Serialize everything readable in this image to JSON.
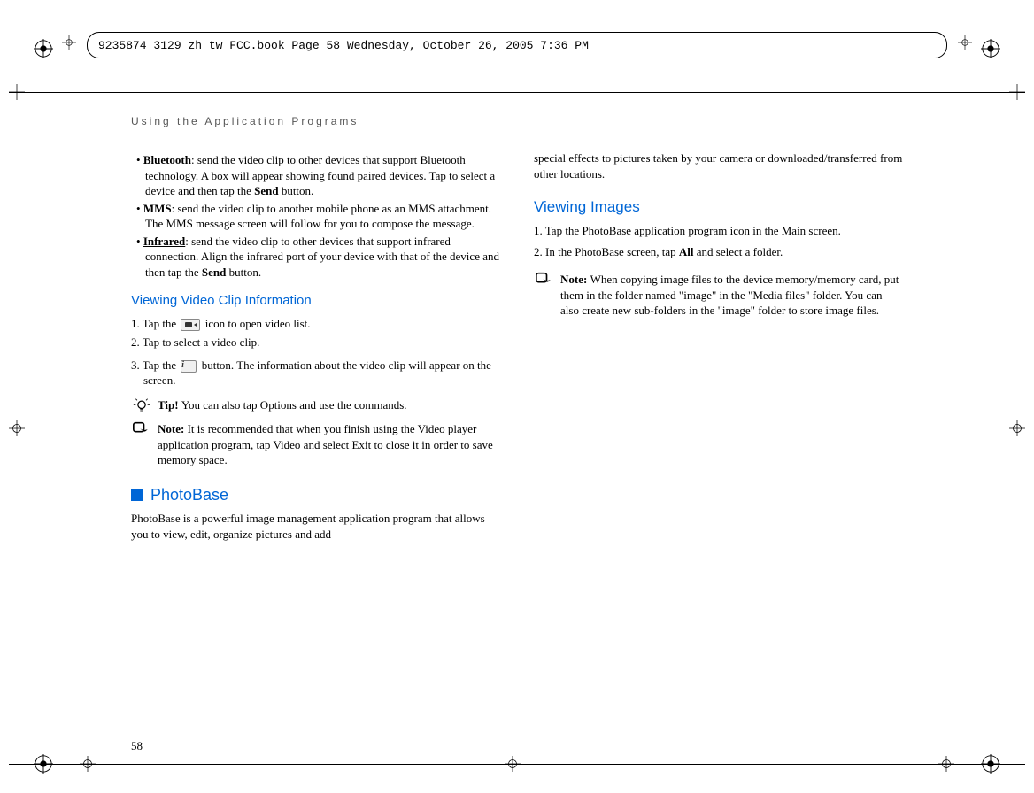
{
  "meta": {
    "framemaker_header": "9235874_3129_zh_tw_FCC.book  Page 58  Wednesday, October 26, 2005  7:36 PM",
    "running_head": "Using the Application Programs",
    "page_number": "58"
  },
  "left": {
    "bluetooth": {
      "label": "Bluetooth",
      "sep": ": ",
      "text1": "send the video clip to other devices that support Bluetooth technology. A box will appear showing found paired devices. Tap to select a device and then tap the ",
      "send": "Send",
      "text2": " button."
    },
    "mms": {
      "label": "MMS",
      "sep": ": ",
      "text": "send the video clip to another mobile phone as an MMS attachment. The MMS message screen will follow for you to compose the message."
    },
    "infrared": {
      "label": "Infrared",
      "sep": ": ",
      "text1": "send the video clip to other devices that support infrared connection. Align the infrared port of your device with that of the device and then tap the ",
      "send": "Send",
      "text2": " button."
    },
    "heading_viewinfo": "Viewing Video Clip Information",
    "step1a": "1. Tap the ",
    "step1b": " icon to open video list.",
    "step2": "2. Tap to select a video clip.",
    "step3a": "3. Tap the ",
    "step3b": " button. The information about the video clip will appear on the screen.",
    "tip_label": "Tip! ",
    "tip_text": "You can also tap Options and use the commands.",
    "note_label": "Note: ",
    "note_text": "It is recommended that when you finish using the Video player application program, tap Video and select Exit to close it in order to save memory space.",
    "heading_photobase": "PhotoBase",
    "photobase_intro": "PhotoBase is a powerful image management application program that allows you to view, edit, organize pictures and add"
  },
  "right": {
    "cont": "special effects to pictures taken by your camera or downloaded/transferred from other locations.",
    "heading_viewing": "Viewing Images",
    "step1": "1. Tap the PhotoBase application program icon in the Main screen.",
    "step2a": "2. In the PhotoBase screen, tap ",
    "step2_all": "All",
    "step2b": " and select a folder.",
    "note_label": "Note: ",
    "note_text": "When copying image files to the device memory/memory card, put them in the folder named \"image\" in the \"Media files\" folder. You can also create new sub-folders in the \"image\" folder to store image files."
  }
}
